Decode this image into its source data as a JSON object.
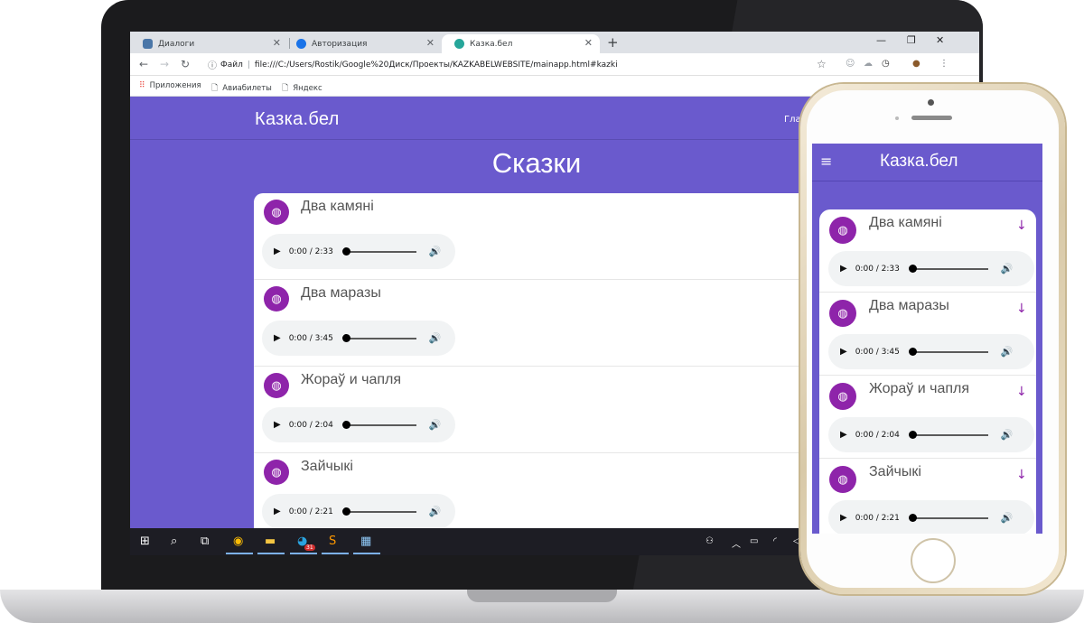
{
  "browser": {
    "tabs": [
      {
        "label": "Диалоги",
        "color": "#4a76a8"
      },
      {
        "label": "Авторизация",
        "color": "#1a73e8"
      },
      {
        "label": "Казка.бел",
        "color": "#26a69a",
        "active": true
      }
    ],
    "url_prefix": "Файл",
    "url": "file:///C:/Users/Rostik/Google%20Диск/Проекты/KAZKABELWEBSITE/mainapp.html#kazki",
    "bookmarks": [
      "Приложения",
      "Авиабилеты",
      "Яндекс"
    ]
  },
  "site": {
    "logo": "Казка.бел",
    "nav_partial": "Гла",
    "title": "Сказки",
    "accent": "#6a5acd",
    "avatar_color": "#8e24aa"
  },
  "stories": [
    {
      "title": "Два камяні",
      "time": "0:00 / 2:33"
    },
    {
      "title": "Два маразы",
      "time": "0:00 / 3:45"
    },
    {
      "title": "Жораў и чапля",
      "time": "0:00 / 2:04"
    },
    {
      "title": "Зайчыкі",
      "time": "0:00 / 2:21"
    }
  ],
  "mobile": {
    "logo": "Казка.бел",
    "menu_icon": "hamburger-icon",
    "expand_icon": "arrow-down-icon"
  },
  "taskbar": {
    "badge": "31"
  }
}
